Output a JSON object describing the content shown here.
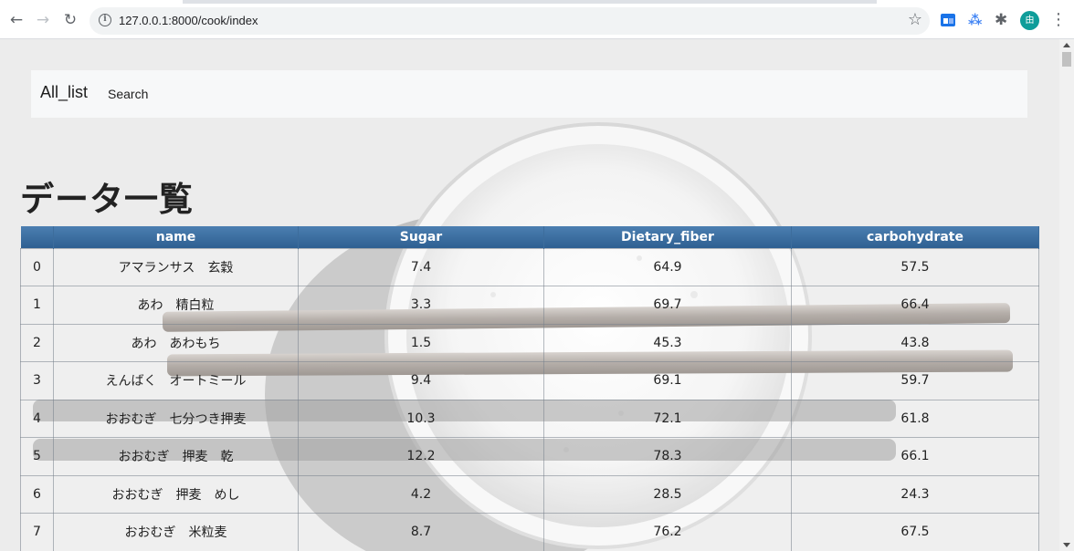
{
  "browser": {
    "url": "127.0.0.1:8000/cook/index",
    "avatar_initial": "由"
  },
  "navbar": {
    "brand": "All_list",
    "search_link": "Search"
  },
  "page": {
    "title": "データ一覧"
  },
  "table": {
    "columns": [
      "",
      "name",
      "Sugar",
      "Dietary_fiber",
      "carbohydrate"
    ],
    "rows": [
      {
        "index": "0",
        "name": "アマランサス　玄穀",
        "sugar": "7.4",
        "fiber": "64.9",
        "carb": "57.5"
      },
      {
        "index": "1",
        "name": "あわ　精白粒",
        "sugar": "3.3",
        "fiber": "69.7",
        "carb": "66.4"
      },
      {
        "index": "2",
        "name": "あわ　あわもち",
        "sugar": "1.5",
        "fiber": "45.3",
        "carb": "43.8"
      },
      {
        "index": "3",
        "name": "えんばく　オートミール",
        "sugar": "9.4",
        "fiber": "69.1",
        "carb": "59.7"
      },
      {
        "index": "4",
        "name": "おおむぎ　七分つき押麦",
        "sugar": "10.3",
        "fiber": "72.1",
        "carb": "61.8"
      },
      {
        "index": "5",
        "name": "おおむぎ　押麦　乾",
        "sugar": "12.2",
        "fiber": "78.3",
        "carb": "66.1"
      },
      {
        "index": "6",
        "name": "おおむぎ　押麦　めし",
        "sugar": "4.2",
        "fiber": "28.5",
        "carb": "24.3"
      },
      {
        "index": "7",
        "name": "おおむぎ　米粒麦",
        "sugar": "8.7",
        "fiber": "76.2",
        "carb": "67.5"
      }
    ]
  },
  "colors": {
    "header_blue": "#2e5f91",
    "avatar": "#0f9d9a"
  }
}
